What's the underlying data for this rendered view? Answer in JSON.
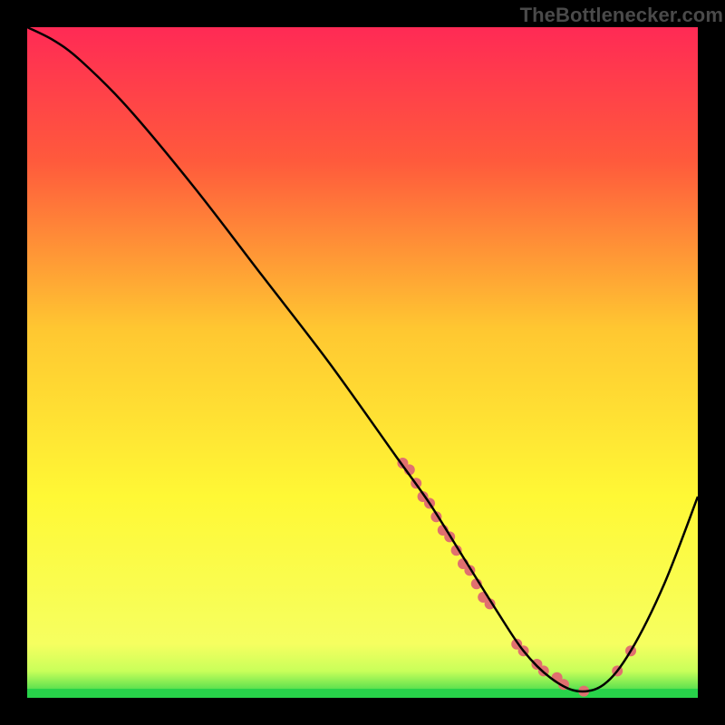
{
  "watermark": {
    "text": "TheBottlenecker.com"
  },
  "colors": {
    "background": "#000000",
    "watermark": "#4a4a4a",
    "curve": "#000000",
    "dot": "#e0706f",
    "green_band": "#28d34a"
  },
  "chart_data": {
    "type": "line",
    "title": "",
    "xlabel": "",
    "ylabel": "",
    "xlim": [
      0,
      100
    ],
    "ylim": [
      0,
      100
    ],
    "gradient_stops": [
      {
        "pct": 0,
        "color": "#ff2a55"
      },
      {
        "pct": 20,
        "color": "#ff5a3c"
      },
      {
        "pct": 45,
        "color": "#ffc731"
      },
      {
        "pct": 70,
        "color": "#fff835"
      },
      {
        "pct": 92,
        "color": "#f6ff60"
      },
      {
        "pct": 96,
        "color": "#c9ff5a"
      },
      {
        "pct": 100,
        "color": "#28d34a"
      }
    ],
    "series": [
      {
        "name": "bottleneck-curve",
        "x": [
          0,
          4,
          8,
          15,
          25,
          35,
          45,
          55,
          60,
          65,
          70,
          74,
          78,
          82,
          86,
          90,
          95,
          100
        ],
        "y": [
          100,
          98,
          95,
          88,
          76,
          63,
          50,
          36,
          29,
          21,
          13,
          7,
          3,
          1,
          2,
          7,
          17,
          30
        ]
      }
    ],
    "dots": {
      "name": "highlight-dots",
      "x": [
        56,
        57,
        58,
        59,
        60,
        61,
        62,
        63,
        64,
        65,
        66,
        67,
        68,
        69,
        73,
        74,
        76,
        77,
        79,
        80,
        83,
        88,
        90
      ],
      "y": [
        35,
        34,
        32,
        30,
        29,
        27,
        25,
        24,
        22,
        20,
        19,
        17,
        15,
        14,
        8,
        7,
        5,
        4,
        3,
        2,
        1,
        4,
        7
      ],
      "r": 6
    }
  }
}
